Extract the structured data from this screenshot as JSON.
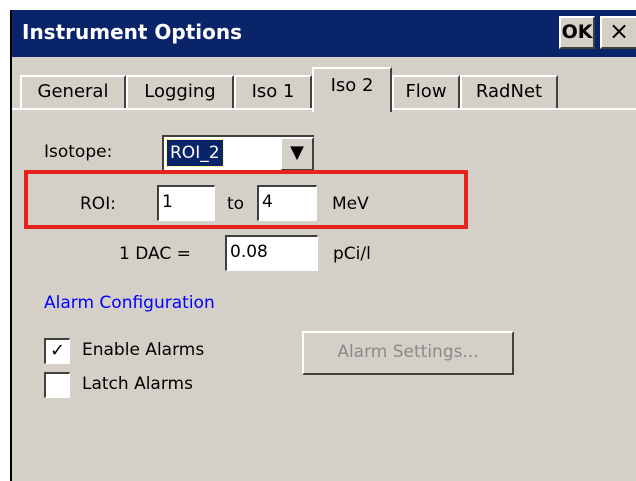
{
  "window": {
    "title": "Instrument Options",
    "ok_label": "OK",
    "close_label": "×"
  },
  "tabs": [
    {
      "label": "General",
      "active": false
    },
    {
      "label": "Logging",
      "active": false
    },
    {
      "label": "Iso 1",
      "active": false
    },
    {
      "label": "Iso 2",
      "active": true
    },
    {
      "label": "Flow",
      "active": false
    },
    {
      "label": "RadNet",
      "active": false
    }
  ],
  "form": {
    "isotope_label": "Isotope:",
    "isotope_value": "ROI_2",
    "roi_label": "ROI:",
    "roi_from": "1",
    "roi_to_label": "to",
    "roi_to": "4",
    "roi_unit": "MeV",
    "dac_label": "1 DAC =",
    "dac_value": "0.08",
    "dac_unit": "pCi/l"
  },
  "alarm": {
    "section_label": "Alarm Configuration",
    "enable_label": "Enable Alarms",
    "enable_checked": true,
    "latch_label": "Latch Alarms",
    "latch_checked": false,
    "settings_button": "Alarm Settings..."
  },
  "colors": {
    "titlebar": "#0a246a",
    "highlight": "#e8231d",
    "link": "#0000ff",
    "face": "#d4d0c8"
  },
  "icons": {
    "dropdown": "chevron-down-icon",
    "check": "checkmark-icon",
    "close": "close-icon"
  }
}
